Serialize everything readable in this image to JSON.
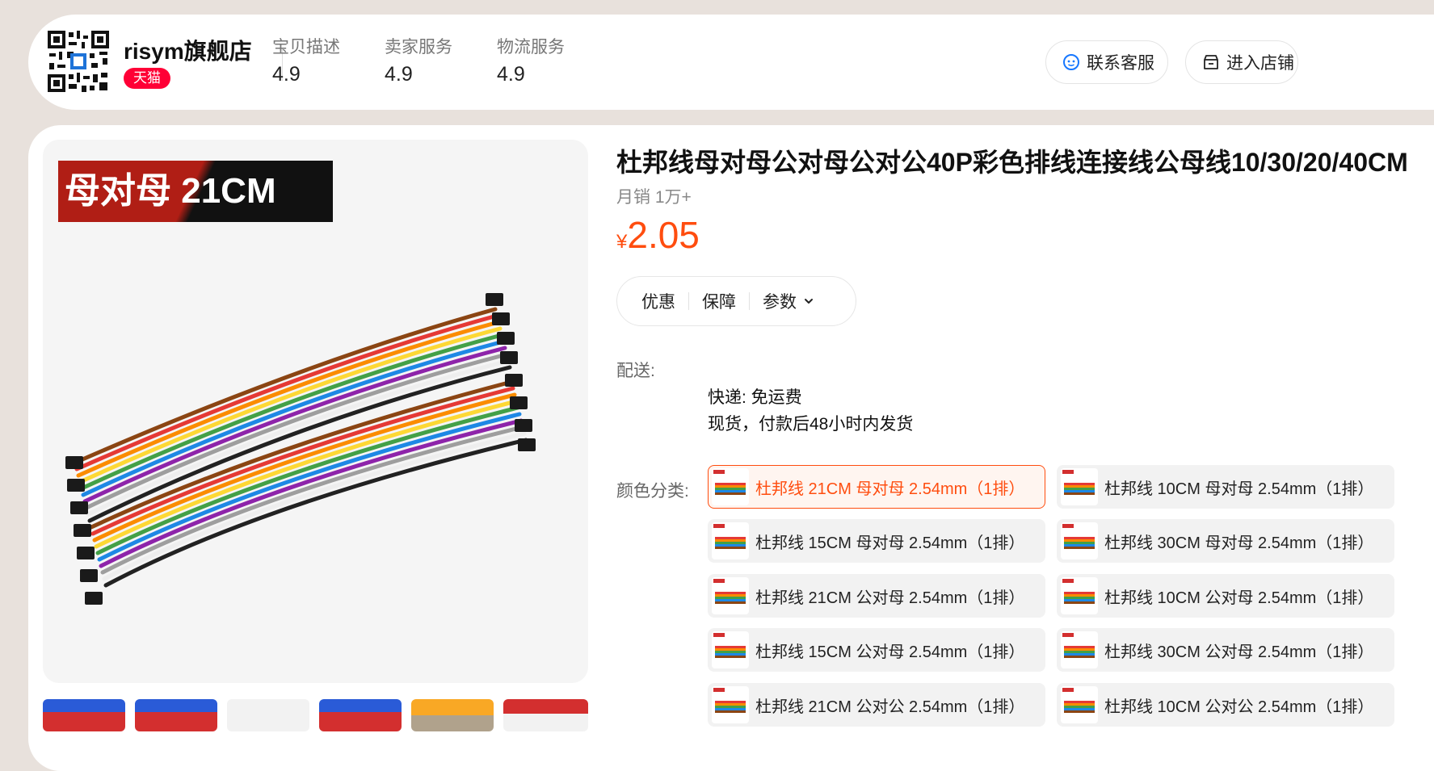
{
  "shop": {
    "name": "risym旗舰店",
    "badge": "天猫",
    "scores": [
      {
        "label": "宝贝描述",
        "value": "4.9"
      },
      {
        "label": "卖家服务",
        "value": "4.9"
      },
      {
        "label": "物流服务",
        "value": "4.9"
      }
    ],
    "contact_label": "联系客服",
    "enter_shop_label": "进入店铺"
  },
  "gallery": {
    "banner_text": "母对母 21CM"
  },
  "product": {
    "title": "杜邦线母对母公对母公对公40P彩色排线连接线公母线10/30/20/40CM",
    "monthly_sales": "月销 1万+",
    "currency": "¥",
    "price": "2.05",
    "tabs": [
      "优惠",
      "保障",
      "参数"
    ]
  },
  "shipping": {
    "label": "配送:",
    "express": "快递: 免运费",
    "stock": "现货，付款后48小时内发货"
  },
  "sku": {
    "label": "颜色分类:",
    "options": [
      "杜邦线 21CM 母对母 2.54mm（1排）",
      "杜邦线 10CM 母对母 2.54mm（1排）",
      "杜邦线 15CM 母对母 2.54mm（1排）",
      "杜邦线 30CM 母对母 2.54mm（1排）",
      "杜邦线 21CM 公对母 2.54mm（1排）",
      "杜邦线 10CM 公对母 2.54mm（1排）",
      "杜邦线 15CM 公对母 2.54mm（1排）",
      "杜邦线 30CM 公对母 2.54mm（1排）",
      "杜邦线 21CM 公对公 2.54mm（1排）",
      "杜邦线 10CM 公对公 2.54mm（1排）"
    ],
    "selected_index": 0
  },
  "colors": {
    "accent": "#ff4d0f",
    "tmall_red": "#ff0036",
    "background": "#e8e1dc"
  }
}
